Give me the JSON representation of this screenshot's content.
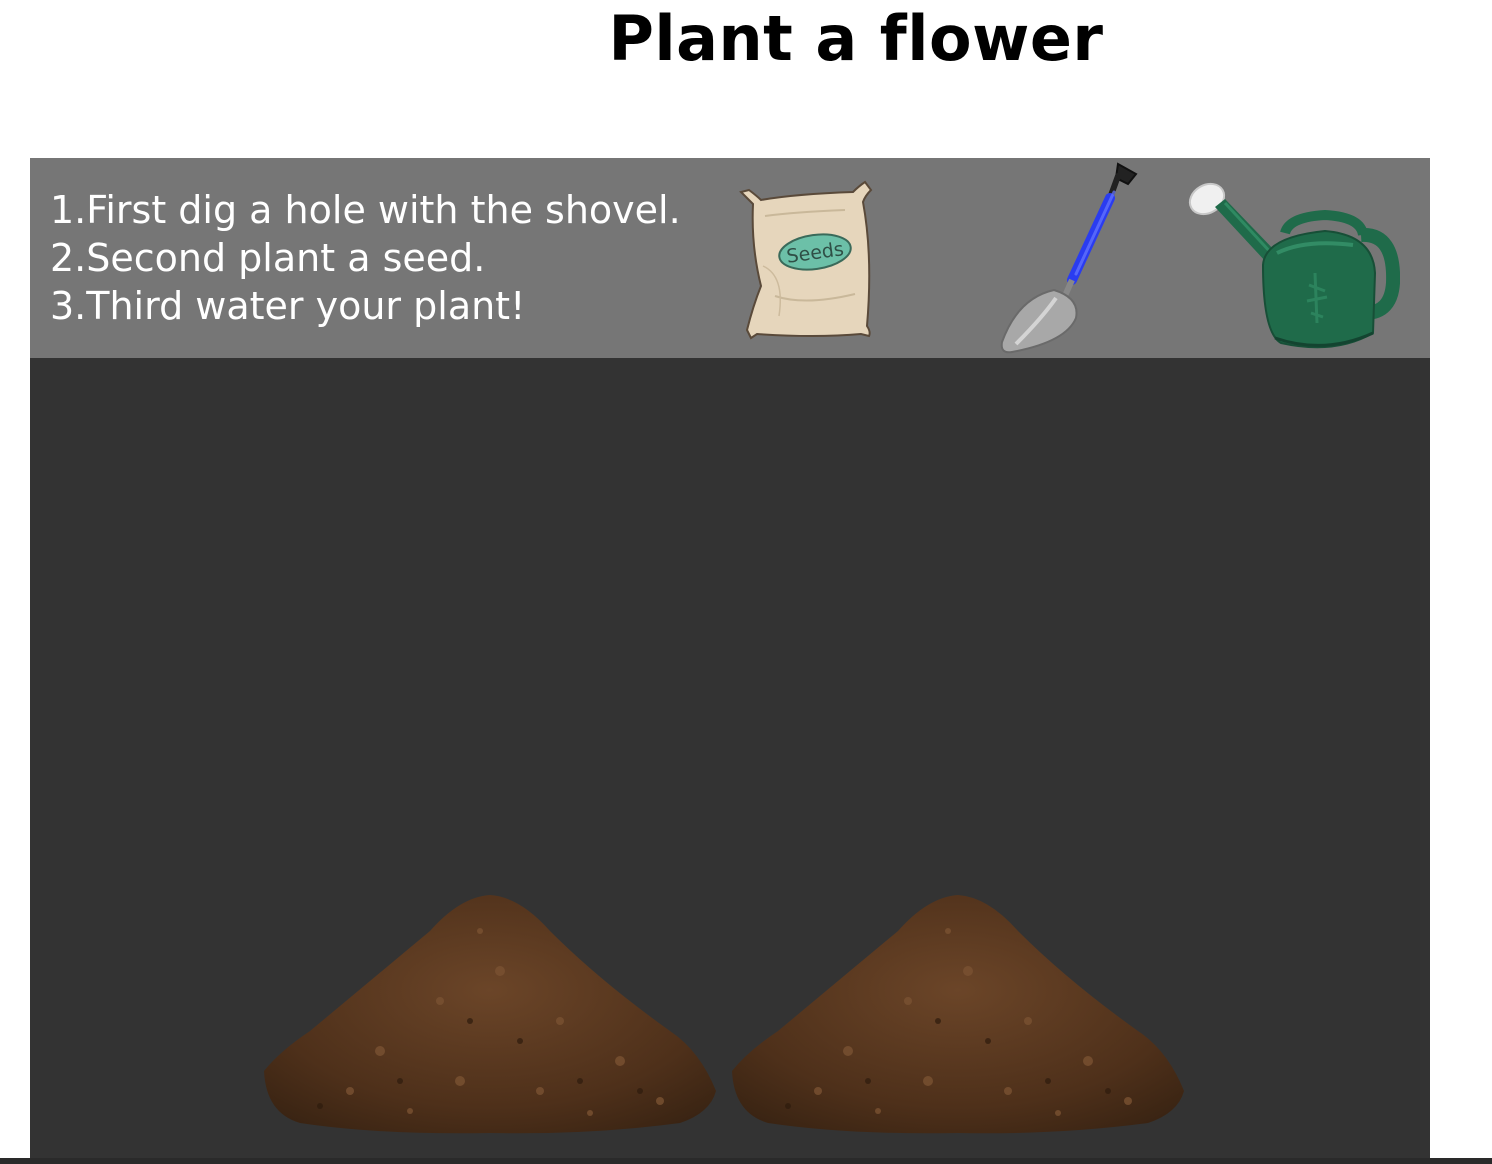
{
  "page": {
    "title": "Plant a flower"
  },
  "instructions": [
    "1.First dig a hole with the shovel.",
    "2.Second plant a seed.",
    "3.Third water your plant!"
  ],
  "tools": {
    "seeds_label": "Seeds"
  },
  "colors": {
    "stage_background": "#333333",
    "toolbar_background": "#767676",
    "soil": "#5b3a22",
    "watering_can": "#1f6b4a",
    "shovel_handle": "#2a3cf0",
    "seed_bag": "#e6d6bc",
    "seed_label": "#6cc0a8"
  },
  "icons": {
    "seed_packet": "seed-packet-icon",
    "shovel": "shovel-icon",
    "watering_can": "watering-can-icon",
    "soil_mound": "soil-mound-icon"
  }
}
